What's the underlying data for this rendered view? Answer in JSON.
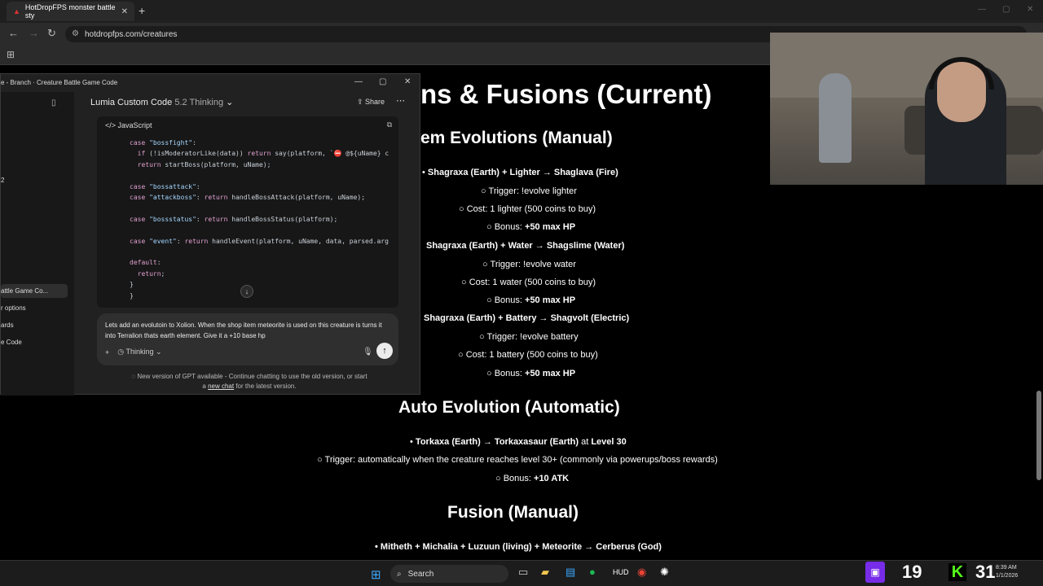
{
  "browser": {
    "tab_title": "HotDropFPS monster battle sty",
    "url": "hotdropfps.com/creatures"
  },
  "page": {
    "heading": "ns & Fusions (Current)",
    "item_section": "em Evolutions (Manual)",
    "items": [
      {
        "title_pre": "Shagraxa (Earth) + Lighter → ",
        "title_result": "Shaglava (Fire)",
        "trigger": "Trigger: !evolve lighter",
        "cost": "Cost: 1 lighter (500 coins to buy)",
        "bonus_label": "Bonus: ",
        "bonus_value": "+50 max HP"
      },
      {
        "title_pre": "Shagraxa (Earth) + Water → ",
        "title_result": "Shagslime (Water)",
        "trigger": "Trigger: !evolve water",
        "cost": "Cost: 1 water (500 coins to buy)",
        "bonus_label": "Bonus: ",
        "bonus_value": "+50 max HP"
      },
      {
        "title_pre": "Shagraxa (Earth) + Battery → ",
        "title_result": "Shagvolt (Electric)",
        "trigger": "Trigger: !evolve battery",
        "cost": "Cost: 1 battery (500 coins to buy)",
        "bonus_label": "Bonus: ",
        "bonus_value": "+50 max HP"
      }
    ],
    "auto_section": "Auto Evolution (Automatic)",
    "auto": {
      "title_pre": "Torkaxa (Earth) → ",
      "title_result": "Torkaxasaur (Earth)",
      "at": " at ",
      "level": "Level 30",
      "trigger": "Trigger: automatically when the creature reaches level 30+ (commonly via powerups/boss rewards)",
      "bonus_label": "Bonus: ",
      "bonus_value": "+10 ATK"
    },
    "fusion_section": "Fusion (Manual)",
    "fusion": "Mitheth + Michalia + Luzuun (living) + Meteorite → Cerberus (God)"
  },
  "chat": {
    "window_title": "e - Branch · Creature Battle Game Code",
    "model_name": "Lumia Custom Code",
    "model_version": "5.2 Thinking",
    "share": "Share",
    "sidebar": {
      "number": "2",
      "items": [
        "attle Game Co...",
        "r options",
        "ards",
        "e Code"
      ]
    },
    "code_lang": "JavaScript",
    "input_text": "Lets add an evolutoin to Xolion. When the shop item meteorite is used on this creature is turns it into Terralion thats earth element. Give it a +10 base hp",
    "thinking_label": "Thinking",
    "notice_line1": "New version of GPT available - Continue chatting to use the old version, or start",
    "notice_line2_pre": "a ",
    "notice_link": "new chat",
    "notice_line2_post": " for the latest version."
  },
  "taskbar": {
    "search": "Search",
    "time": "8:39 AM",
    "date": "1/1/2026"
  },
  "overlay": {
    "count1": "19",
    "count2": "31"
  }
}
